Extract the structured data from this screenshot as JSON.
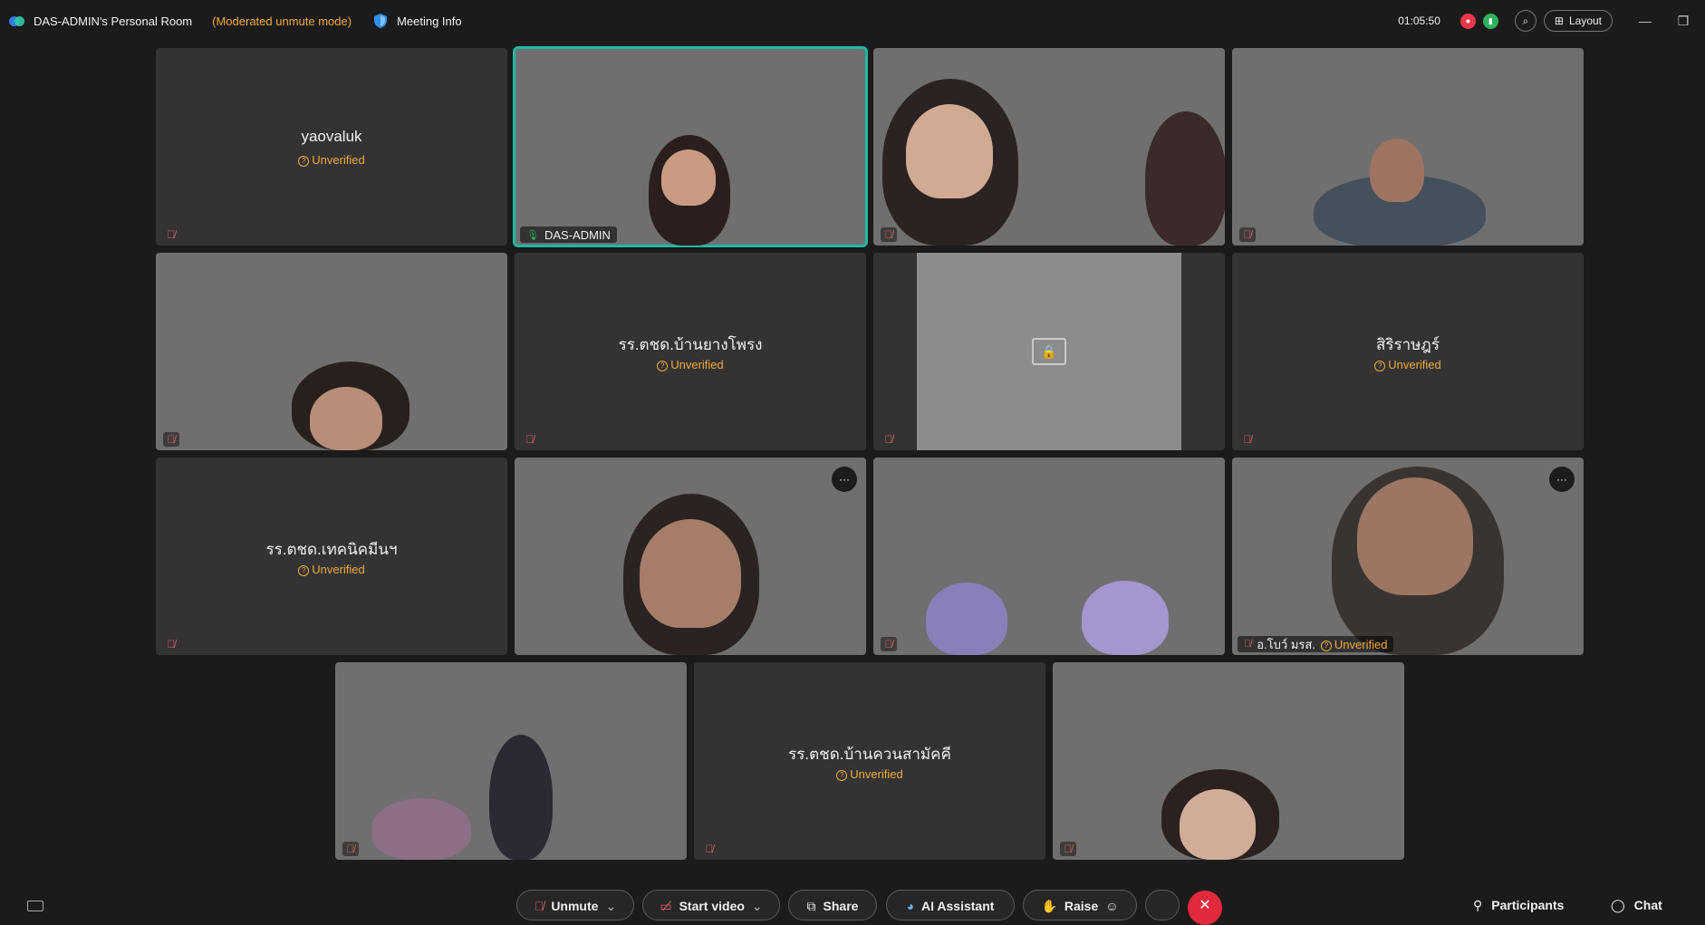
{
  "topbar": {
    "room_name": "DAS-ADMIN's Personal Room",
    "mode": "(Moderated unmute mode)",
    "meeting_info": "Meeting Info",
    "timer": "01:05:50",
    "layout_label": "Layout"
  },
  "tiles": {
    "yaovaluk": {
      "name": "yaovaluk",
      "status": "Unverified"
    },
    "das_admin": {
      "name": "DAS-ADMIN"
    },
    "yangphong": {
      "name": "รร.ตชด.บ้านยางโพรง",
      "status": "Unverified"
    },
    "sirarat": {
      "name": "สิริราษฎร์",
      "status": "Unverified"
    },
    "technic": {
      "name": "รร.ตชด.เทคนิคมีนฯ",
      "status": "Unverified"
    },
    "obor": {
      "name": "อ.โบว์ มรส.",
      "status": "Unverified"
    },
    "kuansamakkhi": {
      "name": "รร.ตชด.บ้านควนสามัคคี",
      "status": "Unverified"
    }
  },
  "toolbar": {
    "unmute": "Unmute",
    "start_video": "Start video",
    "share": "Share",
    "ai_assistant": "AI Assistant",
    "raise": "Raise",
    "participants": "Participants",
    "chat": "Chat"
  },
  "colors": {
    "accent_active": "#1fb8a3",
    "warning": "#f2a93b",
    "end_call": "#e2293c",
    "mute_icon": "#e35d6a"
  },
  "icons": {
    "mute": "mic-off-icon",
    "unverified": "question-circle-icon",
    "more": "ellipsis-icon",
    "share_lock": "locked-share-icon"
  }
}
